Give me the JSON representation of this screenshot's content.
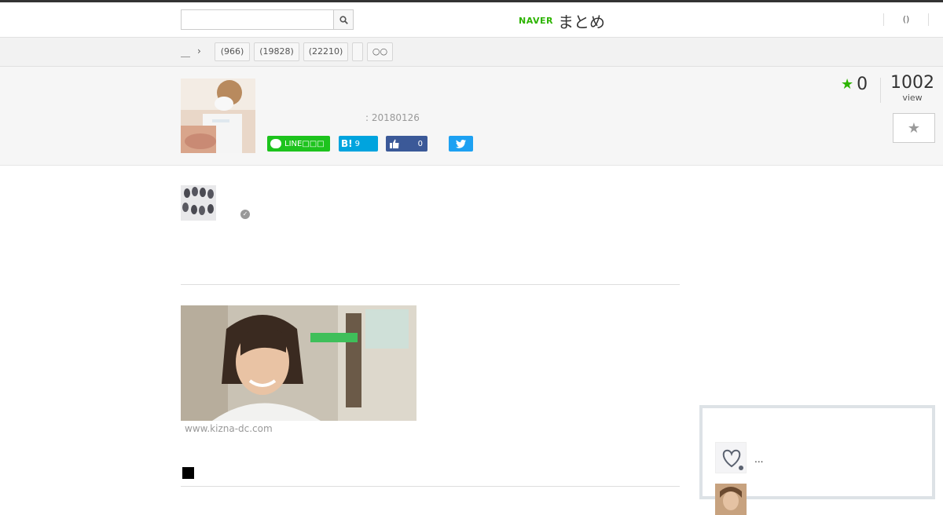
{
  "header": {
    "search_placeholder": "",
    "logo_brand": "NAVER",
    "logo_name": "まとめ",
    "right_link": "()"
  },
  "breadcrumb": {
    "home": "＿",
    "chips": [
      "(966)",
      "(19828)",
      "(22210)",
      "",
      "○○"
    ]
  },
  "article": {
    "date": ": 20180126",
    "favorites": "0",
    "views": "1002",
    "views_label": "view",
    "share": {
      "line": "LINE□□□",
      "hatena": "B!",
      "hatena_count": "9",
      "facebook_count": "0"
    }
  },
  "content": {
    "image_source": "www.kizna-dc.com"
  },
  "sidebar": {
    "item1": "..."
  },
  "colors": {
    "brand_green": "#2db400",
    "line_green": "#1dc31d",
    "hatena_blue": "#00a4de",
    "facebook_blue": "#3b5998",
    "twitter_blue": "#1da1f2"
  }
}
